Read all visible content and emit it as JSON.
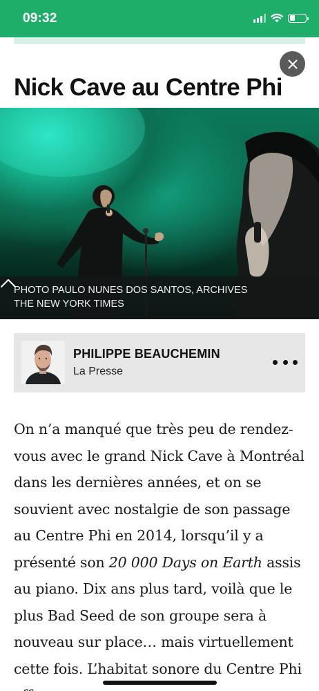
{
  "status_bar": {
    "time": "09:32",
    "signal_icon": "cellular-signal-icon",
    "wifi_icon": "wifi-icon",
    "battery_icon": "battery-icon",
    "battery_level": 0.35,
    "background": "#1fae6a"
  },
  "article": {
    "title": "Nick Cave au Centre Phi",
    "close_icon": "close-icon",
    "photo": {
      "caption_line1": "PHOTO PAULO NUNES DOS SANTOS, ARCHIVES",
      "caption_line2": "THE NEW YORK TIMES",
      "toggle_icon": "chevron-up-icon"
    },
    "author": {
      "name": "PHILIPPE BEAUCHEMIN",
      "outlet": "La Presse",
      "more_icon": "more-dots-icon"
    },
    "body": {
      "p1_a": "On n’a manqué que très peu de ren­dez-vous avec le grand Nick Cave à Montréal dans les dernières années, et on se souvient avec nostalgie de son passage au Centre Phi en 2014, lorsqu’il y a présenté son ",
      "p1_em1": "20 000 Days on Earth",
      "p1_b": " assis au piano. Dix ans plus tard, voilà que le plus Bad Seed de son groupe sera à nouveau sur place… mais virtuellement cette fois. L’habitat sonore du Centre Phi offre"
    }
  },
  "colors": {
    "accent_green": "#1fae6a",
    "strip_mint": "#d6f2e8",
    "author_box_bg": "#e6e6e6"
  }
}
